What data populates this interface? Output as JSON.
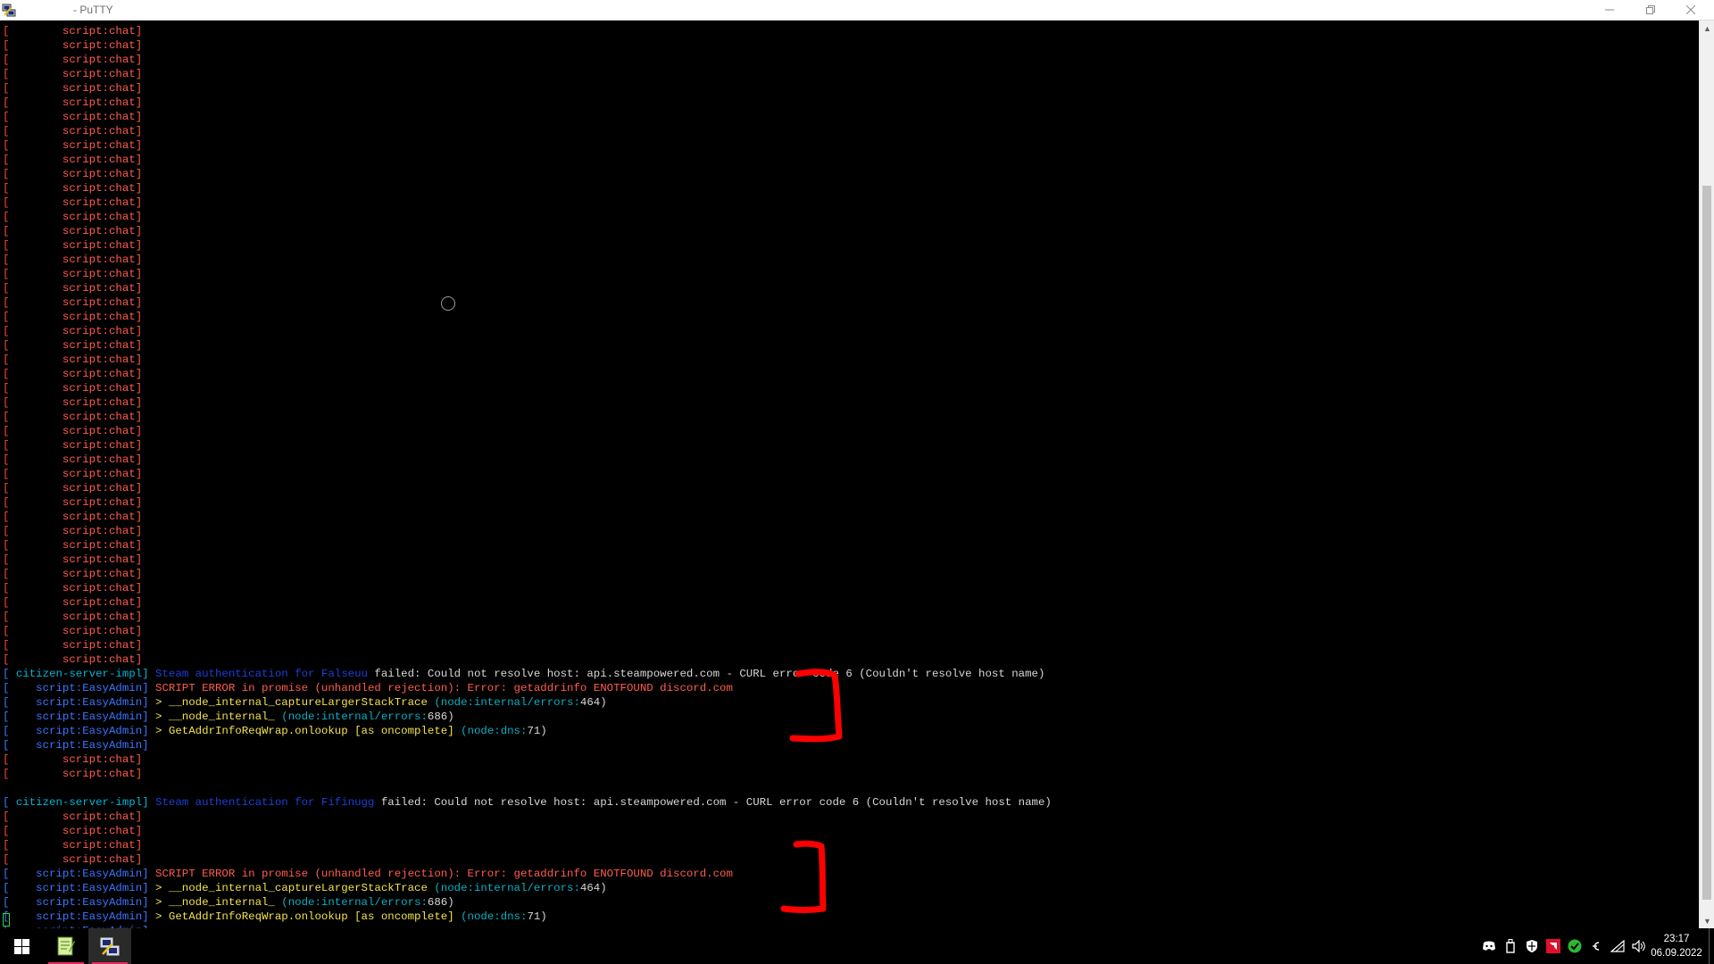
{
  "window": {
    "title": "- PuTTY",
    "icon": "putty-icon",
    "buttons": {
      "minimize": "minimize-icon",
      "maximize": "restore-icon",
      "close": "close-icon"
    }
  },
  "terminal": {
    "colors": {
      "bracket_red": "#ff4a3a",
      "bracket_blue": "#3a7bff",
      "red": "#ff5c4f",
      "cyan": "#00b6d6",
      "blue": "#3c76ff",
      "dark_blue": "#1b3fd8",
      "white": "#d8d8d8",
      "yellow": "#f2e34a",
      "teal": "#0ab0c4",
      "cursor": "#29d94b",
      "annotation": "#ff0000"
    },
    "lines": [
      [
        {
          "t": "[",
          "c": "br"
        },
        {
          "t": "        script:chat]",
          "c": "red"
        }
      ],
      [
        {
          "t": "[",
          "c": "br"
        },
        {
          "t": "        script:chat]",
          "c": "red"
        }
      ],
      [
        {
          "t": "[",
          "c": "br"
        },
        {
          "t": "        script:chat]",
          "c": "red"
        }
      ],
      [
        {
          "t": "[",
          "c": "br"
        },
        {
          "t": "        script:chat]",
          "c": "red"
        }
      ],
      [
        {
          "t": "[",
          "c": "br"
        },
        {
          "t": "        script:chat]",
          "c": "red"
        }
      ],
      [
        {
          "t": "[",
          "c": "br"
        },
        {
          "t": "        script:chat]",
          "c": "red"
        }
      ],
      [
        {
          "t": "[",
          "c": "br"
        },
        {
          "t": "        script:chat]",
          "c": "red"
        }
      ],
      [
        {
          "t": "[",
          "c": "br"
        },
        {
          "t": "        script:chat]",
          "c": "red"
        }
      ],
      [
        {
          "t": "[",
          "c": "br"
        },
        {
          "t": "        script:chat]",
          "c": "red"
        }
      ],
      [
        {
          "t": "[",
          "c": "br"
        },
        {
          "t": "        script:chat]",
          "c": "red"
        }
      ],
      [
        {
          "t": "[",
          "c": "br"
        },
        {
          "t": "        script:chat]",
          "c": "red"
        }
      ],
      [
        {
          "t": "[",
          "c": "br"
        },
        {
          "t": "        script:chat]",
          "c": "red"
        }
      ],
      [
        {
          "t": "[",
          "c": "br"
        },
        {
          "t": "        script:chat]",
          "c": "red"
        }
      ],
      [
        {
          "t": "[",
          "c": "br"
        },
        {
          "t": "        script:chat]",
          "c": "red"
        }
      ],
      [
        {
          "t": "[",
          "c": "br"
        },
        {
          "t": "        script:chat]",
          "c": "red"
        }
      ],
      [
        {
          "t": "[",
          "c": "br"
        },
        {
          "t": "        script:chat]",
          "c": "red"
        }
      ],
      [
        {
          "t": "[",
          "c": "br"
        },
        {
          "t": "        script:chat]",
          "c": "red"
        }
      ],
      [
        {
          "t": "[",
          "c": "br"
        },
        {
          "t": "        script:chat]",
          "c": "red"
        }
      ],
      [
        {
          "t": "[",
          "c": "br"
        },
        {
          "t": "        script:chat]",
          "c": "red"
        }
      ],
      [
        {
          "t": "[",
          "c": "br"
        },
        {
          "t": "        script:chat]",
          "c": "red"
        }
      ],
      [
        {
          "t": "[",
          "c": "br"
        },
        {
          "t": "        script:chat]",
          "c": "red"
        }
      ],
      [
        {
          "t": "[",
          "c": "br"
        },
        {
          "t": "        script:chat]",
          "c": "red"
        }
      ],
      [
        {
          "t": "[",
          "c": "br"
        },
        {
          "t": "        script:chat]",
          "c": "red"
        }
      ],
      [
        {
          "t": "[",
          "c": "br"
        },
        {
          "t": "        script:chat]",
          "c": "red"
        }
      ],
      [
        {
          "t": "[",
          "c": "br"
        },
        {
          "t": "        script:chat]",
          "c": "red"
        }
      ],
      [
        {
          "t": "[",
          "c": "br"
        },
        {
          "t": "        script:chat]",
          "c": "red"
        }
      ],
      [
        {
          "t": "[",
          "c": "br"
        },
        {
          "t": "        script:chat]",
          "c": "red"
        }
      ],
      [
        {
          "t": "[",
          "c": "br"
        },
        {
          "t": "        script:chat]",
          "c": "red"
        }
      ],
      [
        {
          "t": "[",
          "c": "br"
        },
        {
          "t": "        script:chat]",
          "c": "red"
        }
      ],
      [
        {
          "t": "[",
          "c": "br"
        },
        {
          "t": "        script:chat]",
          "c": "red"
        }
      ],
      [
        {
          "t": "[",
          "c": "br"
        },
        {
          "t": "        script:chat]",
          "c": "red"
        }
      ],
      [
        {
          "t": "[",
          "c": "br"
        },
        {
          "t": "        script:chat]",
          "c": "red"
        }
      ],
      [
        {
          "t": "[",
          "c": "br"
        },
        {
          "t": "        script:chat]",
          "c": "red"
        }
      ],
      [
        {
          "t": "[",
          "c": "br"
        },
        {
          "t": "        script:chat]",
          "c": "red"
        }
      ],
      [
        {
          "t": "[",
          "c": "br"
        },
        {
          "t": "        script:chat]",
          "c": "red"
        }
      ],
      [
        {
          "t": "[",
          "c": "br"
        },
        {
          "t": "        script:chat]",
          "c": "red"
        }
      ],
      [
        {
          "t": "[",
          "c": "br"
        },
        {
          "t": "        script:chat]",
          "c": "red"
        }
      ],
      [
        {
          "t": "[",
          "c": "br"
        },
        {
          "t": "        script:chat]",
          "c": "red"
        }
      ],
      [
        {
          "t": "[",
          "c": "br"
        },
        {
          "t": "        script:chat]",
          "c": "red"
        }
      ],
      [
        {
          "t": "[",
          "c": "br"
        },
        {
          "t": "        script:chat]",
          "c": "red"
        }
      ],
      [
        {
          "t": "[",
          "c": "br"
        },
        {
          "t": "        script:chat]",
          "c": "red"
        }
      ],
      [
        {
          "t": "[",
          "c": "br"
        },
        {
          "t": "        script:chat]",
          "c": "red"
        }
      ],
      [
        {
          "t": "[",
          "c": "br"
        },
        {
          "t": "        script:chat]",
          "c": "red"
        }
      ],
      [
        {
          "t": "[",
          "c": "br"
        },
        {
          "t": "        script:chat]",
          "c": "red"
        }
      ],
      [
        {
          "t": "[",
          "c": "br"
        },
        {
          "t": "        script:chat]",
          "c": "red"
        }
      ],
      [
        {
          "t": "[",
          "c": "bb"
        },
        {
          "t": " citizen-server-impl]",
          "c": "cyan"
        },
        {
          "t": " Steam authentication for Falseuu",
          "c": "darkblue"
        },
        {
          "t": " failed: Could not resolve host: api.steampowered.com - CURL error code 6 (Couldn't resolve host name)",
          "c": "white"
        }
      ],
      [
        {
          "t": "[",
          "c": "bb"
        },
        {
          "t": "    script:EasyAdmin]",
          "c": "blue"
        },
        {
          "t": " SCRIPT ERROR in promise (unhandled rejection): Error: getaddrinfo ENOTFOUND discord.com",
          "c": "red"
        }
      ],
      [
        {
          "t": "[",
          "c": "bb"
        },
        {
          "t": "    script:EasyAdmin]",
          "c": "blue"
        },
        {
          "t": " > __node_internal_captureLargerStackTrace",
          "c": "yellow"
        },
        {
          "t": " (node:internal/errors:",
          "c": "teal"
        },
        {
          "t": "464)",
          "c": "white"
        }
      ],
      [
        {
          "t": "[",
          "c": "bb"
        },
        {
          "t": "    script:EasyAdmin]",
          "c": "blue"
        },
        {
          "t": " > __node_internal_",
          "c": "yellow"
        },
        {
          "t": " (node:internal/errors:",
          "c": "teal"
        },
        {
          "t": "686)",
          "c": "white"
        }
      ],
      [
        {
          "t": "[",
          "c": "bb"
        },
        {
          "t": "    script:EasyAdmin]",
          "c": "blue"
        },
        {
          "t": " > GetAddrInfoReqWrap.onlookup [as oncomplete]",
          "c": "yellow"
        },
        {
          "t": " (node:dns:",
          "c": "teal"
        },
        {
          "t": "71)",
          "c": "white"
        }
      ],
      [
        {
          "t": "[",
          "c": "bb"
        },
        {
          "t": "    script:EasyAdmin]",
          "c": "blue"
        }
      ],
      [
        {
          "t": "[",
          "c": "br"
        },
        {
          "t": "        script:chat]",
          "c": "red"
        }
      ],
      [
        {
          "t": "[",
          "c": "br"
        },
        {
          "t": "        script:chat]",
          "c": "red"
        }
      ],
      [],
      [
        {
          "t": "[",
          "c": "bb"
        },
        {
          "t": " citizen-server-impl]",
          "c": "cyan"
        },
        {
          "t": " Steam authentication for Fifinugg",
          "c": "darkblue"
        },
        {
          "t": " failed: Could not resolve host: api.steampowered.com - CURL error code 6 (Couldn't resolve host name)",
          "c": "white"
        }
      ],
      [
        {
          "t": "[",
          "c": "br"
        },
        {
          "t": "        script:chat]",
          "c": "red"
        }
      ],
      [
        {
          "t": "[",
          "c": "br"
        },
        {
          "t": "        script:chat]",
          "c": "red"
        }
      ],
      [
        {
          "t": "[",
          "c": "br"
        },
        {
          "t": "        script:chat]",
          "c": "red"
        }
      ],
      [
        {
          "t": "[",
          "c": "br"
        },
        {
          "t": "        script:chat]",
          "c": "red"
        }
      ],
      [
        {
          "t": "[",
          "c": "bb"
        },
        {
          "t": "    script:EasyAdmin]",
          "c": "blue"
        },
        {
          "t": " SCRIPT ERROR in promise (unhandled rejection): Error: getaddrinfo ENOTFOUND discord.com",
          "c": "red"
        }
      ],
      [
        {
          "t": "[",
          "c": "bb"
        },
        {
          "t": "    script:EasyAdmin]",
          "c": "blue"
        },
        {
          "t": " > __node_internal_captureLargerStackTrace",
          "c": "yellow"
        },
        {
          "t": " (node:internal/errors:",
          "c": "teal"
        },
        {
          "t": "464)",
          "c": "white"
        }
      ],
      [
        {
          "t": "[",
          "c": "bb"
        },
        {
          "t": "    script:EasyAdmin]",
          "c": "blue"
        },
        {
          "t": " > __node_internal_",
          "c": "yellow"
        },
        {
          "t": " (node:internal/errors:",
          "c": "teal"
        },
        {
          "t": "686)",
          "c": "white"
        }
      ],
      [
        {
          "t": "[",
          "c": "bb"
        },
        {
          "t": "    script:EasyAdmin]",
          "c": "blue"
        },
        {
          "t": " > GetAddrInfoReqWrap.onlookup [as oncomplete]",
          "c": "yellow"
        },
        {
          "t": " (node:dns:",
          "c": "teal"
        },
        {
          "t": "71)",
          "c": "white"
        }
      ],
      [
        {
          "t": "[",
          "c": "bb"
        },
        {
          "t": "    script:EasyAdmin]",
          "c": "blue"
        }
      ]
    ],
    "loading_icon": "loading-ring-icon",
    "cursor_icon": "terminal-cursor-icon"
  },
  "scrollbar": {
    "up": "scroll-up-arrow-icon",
    "down": "scroll-down-arrow-icon"
  },
  "taskbar": {
    "start_icon": "windows-start-icon",
    "apps": [
      {
        "name": "notepad-plus-plus",
        "icon": "notepad-icon"
      },
      {
        "name": "putty",
        "icon": "putty-icon"
      }
    ],
    "tray": [
      "discord-icon",
      "usb-drive-icon",
      "security-shield-icon",
      "amd-icon",
      "green-app-icon",
      "chevron-icon",
      "network-icon",
      "volume-icon"
    ],
    "clock_time": "23:17",
    "clock_date": "06.09.2022"
  }
}
